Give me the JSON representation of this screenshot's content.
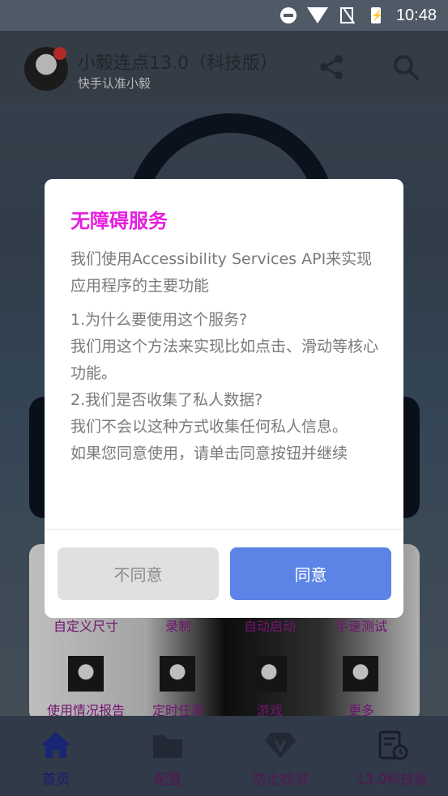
{
  "status_bar": {
    "time": "10:48"
  },
  "header": {
    "title": "小毅连点13.0（科技版）",
    "subtitle": "快手认准小毅"
  },
  "grid": {
    "row1": [
      "自定义尺寸",
      "录制",
      "自动启动",
      "手速测试"
    ],
    "row2": [
      "使用情况报告",
      "定时任务",
      "游戏",
      "更多"
    ]
  },
  "bottom_nav": [
    {
      "label": "首页",
      "icon": "home-icon"
    },
    {
      "label": "配置",
      "icon": "folder-icon"
    },
    {
      "label": "防止检测",
      "icon": "diamond-v-icon"
    },
    {
      "label": "13.0科技版",
      "icon": "document-clock-icon"
    }
  ],
  "dialog": {
    "title": "无障碍服务",
    "intro": "我们使用Accessibility Services API来实现应用程序的主要功能",
    "q1": "1.为什么要使用这个服务?",
    "a1": "我们用这个方法来实现比如点击、滑动等核心功能。",
    "q2": "2.我们是否收集了私人数据?",
    "a2": "我们不会以这种方式收集任何私人信息。",
    "consent": "如果您同意使用，请单击同意按钮并继续",
    "disagree_label": "不同意",
    "agree_label": "同意"
  },
  "colors": {
    "dialog_title": "#e61ee0",
    "agree_button": "#5b84e6",
    "disagree_button": "#e0e0e0"
  }
}
